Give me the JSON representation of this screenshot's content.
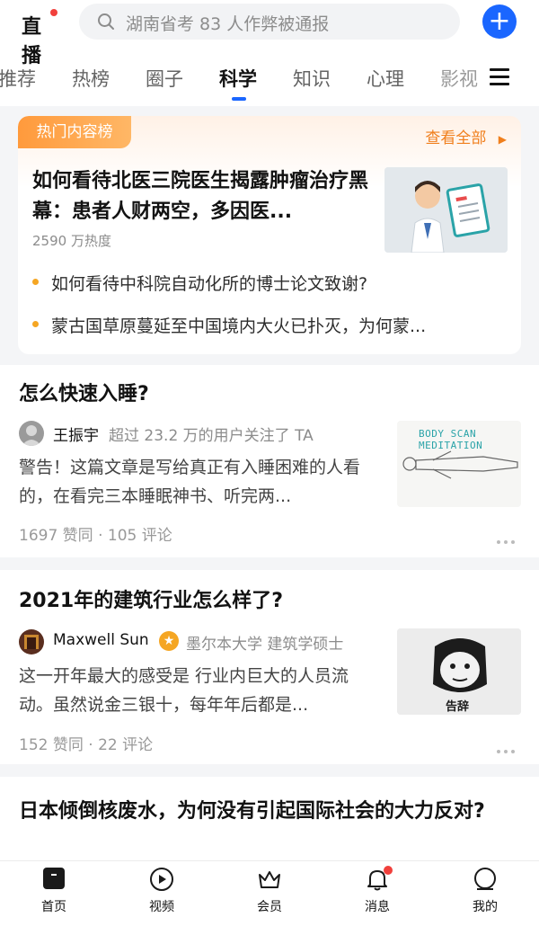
{
  "header": {
    "logo_text": "直播",
    "search_placeholder": "湖南省考 83 人作弊被通报"
  },
  "tabs": [
    {
      "label": "推荐",
      "active": false
    },
    {
      "label": "热榜",
      "active": false
    },
    {
      "label": "圈子",
      "active": false
    },
    {
      "label": "科学",
      "active": true
    },
    {
      "label": "知识",
      "active": false
    },
    {
      "label": "心理",
      "active": false
    },
    {
      "label": "影视",
      "active": false
    }
  ],
  "hot_list": {
    "badge": "热门内容榜",
    "see_all": "查看全部",
    "top": {
      "title": "如何看待北医三院医生揭露肿瘤治疗黑幕：患者人财两空，多因医...",
      "heat": "2590 万热度"
    },
    "items": [
      "如何看待中科院自动化所的博士论文致谢?",
      "蒙古国草原蔓延至中国境内大火已扑灭，为何蒙..."
    ]
  },
  "feed": [
    {
      "title": "怎么快速入睡?",
      "author": "王振宇",
      "author_meta": "超过 23.2 万的用户关注了 TA",
      "excerpt": "警告！这篇文章是写给真正有入睡困难的人看的，在看完三本睡眠神书、听完两...",
      "stats": "1697 赞同 · 105 评论",
      "thumb_caption": "BODY SCAN MEDITATION"
    },
    {
      "title": "2021年的建筑行业怎么样了?",
      "author": "Maxwell Sun",
      "author_meta": "墨尔本大学 建筑学硕士",
      "excerpt": "这一开年最大的感受是 行业内巨大的人员流动。虽然说金三银十，每年年后都是...",
      "stats": "152 赞同 · 22 评论",
      "thumb_caption": "告辞"
    },
    {
      "title": "日本倾倒核废水，为何没有引起国际社会的大力反对?"
    }
  ],
  "bottom_nav": [
    {
      "label": "首页",
      "icon": "home-icon"
    },
    {
      "label": "视频",
      "icon": "video-icon"
    },
    {
      "label": "会员",
      "icon": "crown-icon"
    },
    {
      "label": "消息",
      "icon": "bell-icon"
    },
    {
      "label": "我的",
      "icon": "profile-icon"
    }
  ],
  "colors": {
    "accent": "#1a66ff",
    "hot_orange": "#f07f1d",
    "badge_red": "#f1403c"
  }
}
